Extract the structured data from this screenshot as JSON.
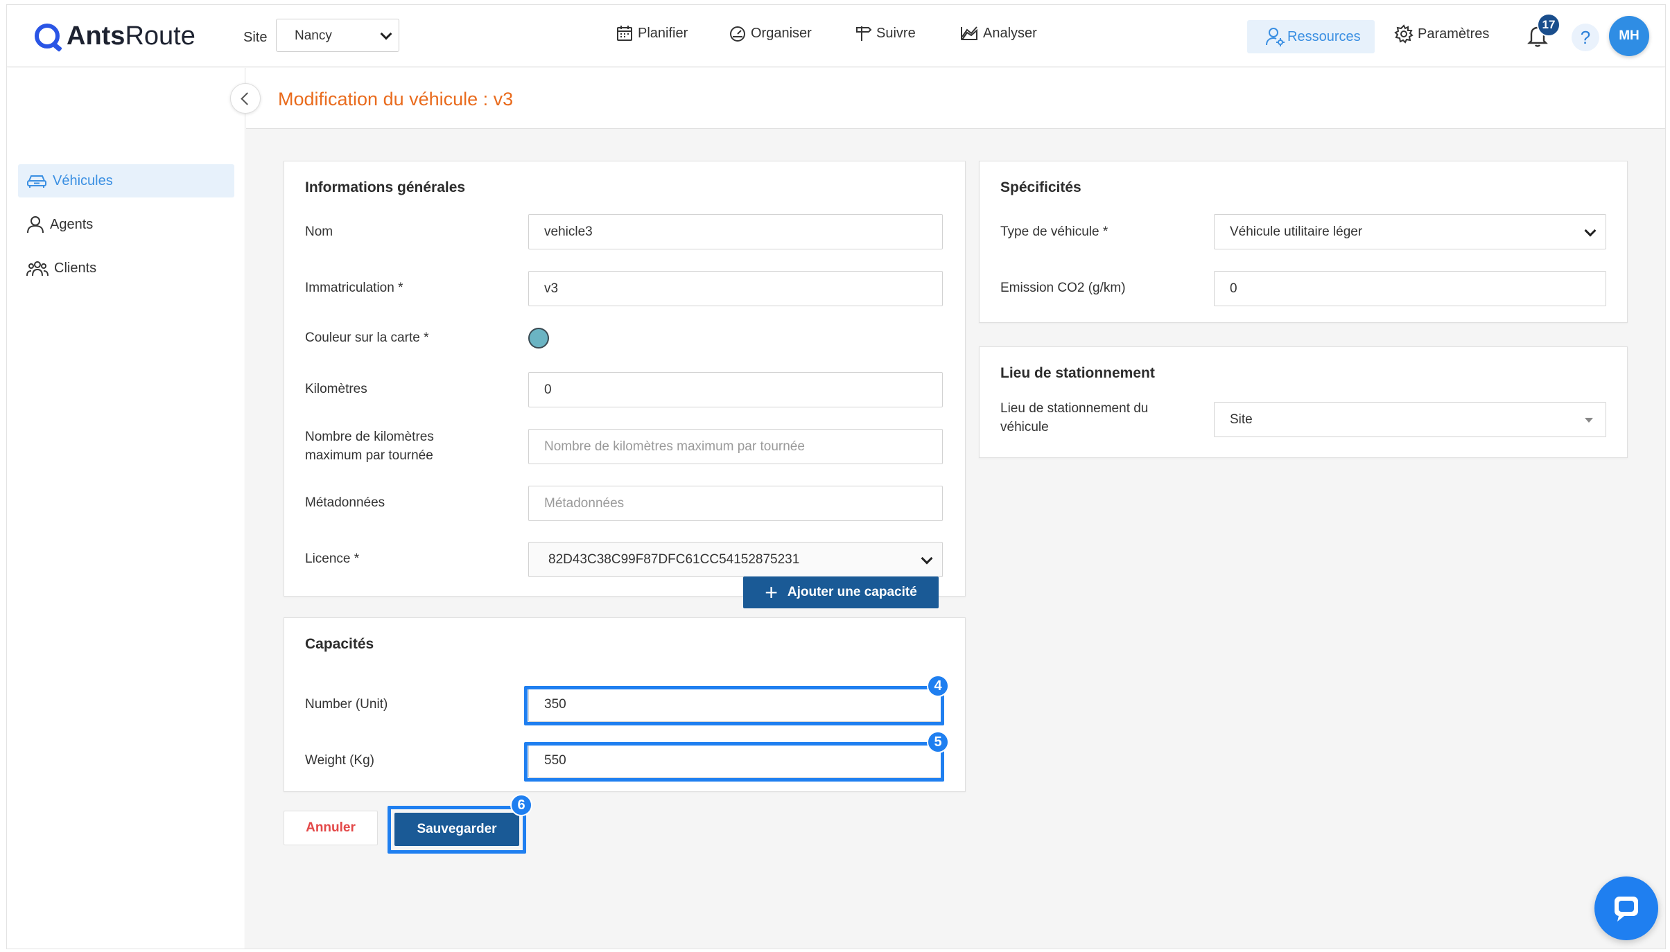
{
  "app": {
    "logo_bold": "Ants",
    "logo_light": "Route"
  },
  "header": {
    "site_label": "Site",
    "site_value": "Nancy",
    "nav": [
      "Planifier",
      "Organiser",
      "Suivre",
      "Analyser"
    ],
    "resources_label": "Ressources",
    "settings_label": "Paramètres",
    "notification_count": "17",
    "help_label": "?",
    "avatar_initials": "MH"
  },
  "sidebar": {
    "items": [
      {
        "label": "Véhicules",
        "icon": "car-icon",
        "active": true
      },
      {
        "label": "Agents",
        "icon": "user-icon",
        "active": false
      },
      {
        "label": "Clients",
        "icon": "users-group-icon",
        "active": false
      }
    ]
  },
  "page": {
    "title": "Modification du véhicule : v3"
  },
  "general": {
    "title": "Informations générales",
    "nom_label": "Nom",
    "nom_value": "vehicle3",
    "immat_label": "Immatriculation *",
    "immat_value": "v3",
    "color_label": "Couleur sur la carte *",
    "color_value": "#6bb4c3",
    "km_label": "Kilomètres",
    "km_value": "0",
    "max_km_label_1": "Nombre de kilomètres",
    "max_km_label_2": "maximum par tournée",
    "max_km_placeholder": "Nombre de kilomètres maximum par tournée",
    "meta_label": "Métadonnées",
    "meta_placeholder": "Métadonnées",
    "licence_label": "Licence *",
    "licence_value": "82D43C38C99F87DFC61CC54152875231"
  },
  "specs": {
    "title": "Spécificités",
    "type_label": "Type de véhicule *",
    "type_value": "Véhicule utilitaire léger",
    "co2_label": "Emission CO2 (g/km)",
    "co2_value": "0"
  },
  "parking": {
    "title": "Lieu de stationnement",
    "label_1": "Lieu de stationnement du",
    "label_2": "véhicule",
    "value": "Site"
  },
  "capacities": {
    "title": "Capacités",
    "add_label": "Ajouter une capacité",
    "number_label": "Number (Unit)",
    "number_value": "350",
    "weight_label": "Weight (Kg)",
    "weight_value": "550"
  },
  "actions": {
    "cancel_label": "Annuler",
    "save_label": "Sauvegarder"
  },
  "markers": [
    "4",
    "5",
    "6"
  ],
  "colors": {
    "accent": "#3a8fe2",
    "primary_button": "#1a5a96",
    "title_orange": "#e96b1d",
    "highlight": "#1f7ff0"
  }
}
